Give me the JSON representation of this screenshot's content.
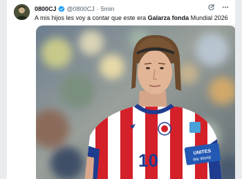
{
  "post": {
    "author_name": "0800CJ",
    "author_handle": "@0800CJ",
    "separator": "·",
    "time": "5min",
    "text_before": "A mis hijos les voy a contar que este era ",
    "text_bold": "Galarza fonda",
    "text_after": " Mundial 2026",
    "verified": true
  },
  "media": {
    "jersey_number": "10",
    "captain_band_line1": "UNITES",
    "captain_band_line2": "We World"
  },
  "colors": {
    "verified": "#1d9bf0",
    "jersey_red": "#d32029",
    "jersey_blue": "#1f3c8f"
  },
  "icons": {
    "action_1": "refresh-icon",
    "action_2": "more-icon"
  }
}
